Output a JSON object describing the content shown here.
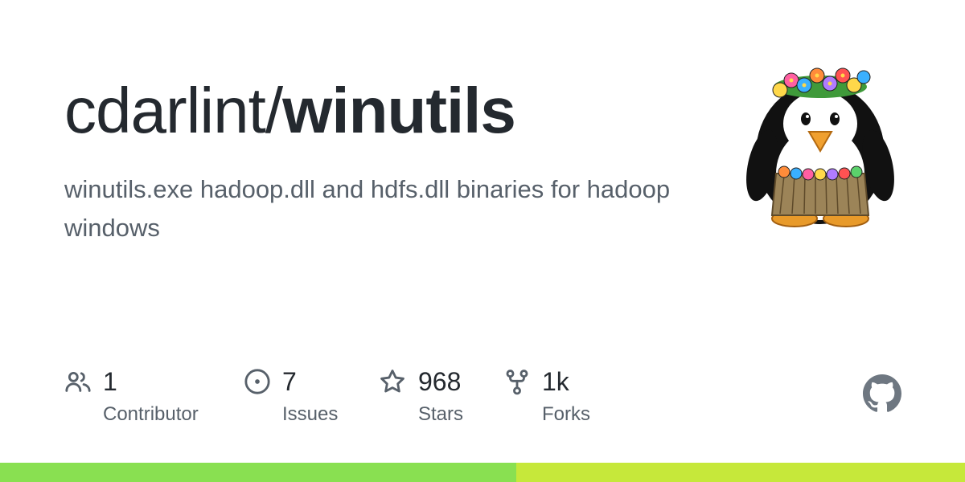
{
  "repo": {
    "owner_prefix": "cdarlint/",
    "name": "winutils",
    "description": "winutils.exe hadoop.dll and hdfs.dll binaries for hadoop windows"
  },
  "avatar": {
    "icon": "hula-penguin-avatar"
  },
  "stats": {
    "contributors": {
      "value": "1",
      "label": "Contributor",
      "icon": "people-icon"
    },
    "issues": {
      "value": "7",
      "label": "Issues",
      "icon": "issue-opened-icon"
    },
    "stars": {
      "value": "968",
      "label": "Stars",
      "icon": "star-icon"
    },
    "forks": {
      "value": "1k",
      "label": "Forks",
      "icon": "repo-forked-icon"
    }
  },
  "github_mark": {
    "icon": "github-mark-icon"
  },
  "language_bar": {
    "segments": [
      {
        "color": "#89e051",
        "fraction": 0.535
      },
      {
        "color": "#c6e83a",
        "fraction": 0.465
      }
    ]
  },
  "colors": {
    "title": "#24292f",
    "muted": "#57606a",
    "icon": "#57606a",
    "github_mark": "#6e7781"
  }
}
